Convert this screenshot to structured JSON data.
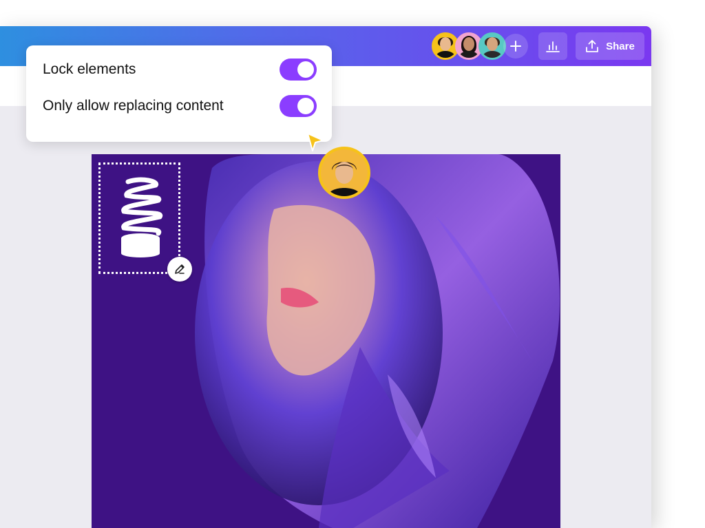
{
  "popup": {
    "items": [
      {
        "label": "Lock elements",
        "enabled": true
      },
      {
        "label": "Only allow replacing content",
        "enabled": true
      }
    ]
  },
  "toolbar": {
    "share_label": "Share",
    "collaborators": [
      "collaborator-avatar",
      "collaborator-avatar",
      "collaborator-avatar"
    ]
  },
  "icons": {
    "add": "plus-icon",
    "insights": "bar-chart-icon",
    "share": "upload-icon",
    "edit": "edit-pencil-icon",
    "cursor": "pointer-cursor-icon"
  },
  "colors": {
    "accent": "#8b3dff",
    "cursor": "#f6c21a",
    "canvas_bg": "#3e1284"
  }
}
